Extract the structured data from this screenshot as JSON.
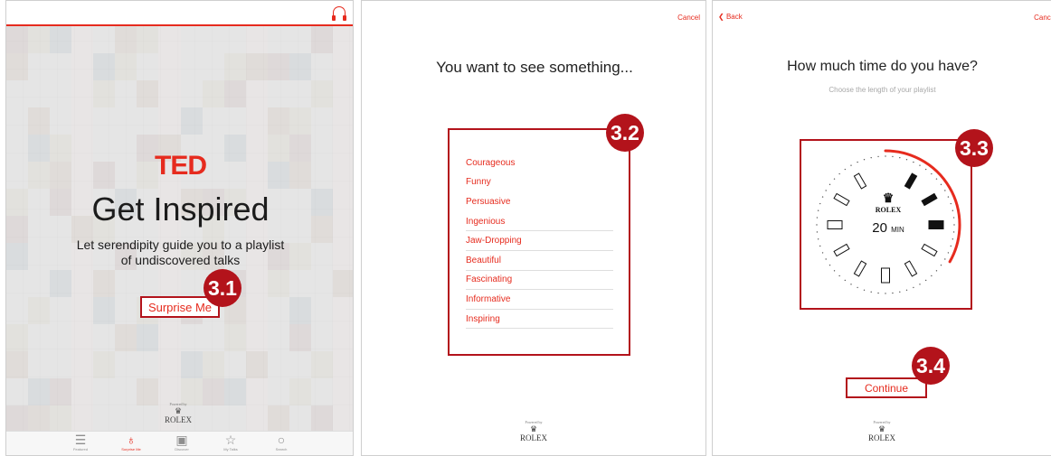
{
  "panel1": {
    "brand": "TED",
    "title": "Get Inspired",
    "subtitle": "Let serendipity guide you to a playlist of undiscovered talks",
    "surprise_button": "Surprise Me",
    "powered_by": "Powered by",
    "sponsor": "ROLEX",
    "tabs": [
      {
        "label": "Featured",
        "icon": "list-icon"
      },
      {
        "label": "Surprise Me",
        "icon": "lightbulb-icon"
      },
      {
        "label": "Discover",
        "icon": "play-box-icon"
      },
      {
        "label": "My Talks",
        "icon": "star-icon"
      },
      {
        "label": "Search",
        "icon": "search-icon"
      }
    ]
  },
  "panel2": {
    "cancel": "Cancel",
    "title": "You want to see something...",
    "options": [
      "Courageous",
      "Funny",
      "Persuasive",
      "Ingenious",
      "Jaw-Dropping",
      "Beautiful",
      "Fascinating",
      "Informative",
      "Inspiring"
    ],
    "powered_by": "Powered by",
    "sponsor": "ROLEX"
  },
  "panel3": {
    "back": "Back",
    "cancel": "Cancel",
    "title": "How much time do you have?",
    "subtitle": "Choose the length of your playlist",
    "dial_brand": "ROLEX",
    "minutes": "20",
    "minutes_unit": "MIN",
    "dial_fraction": 0.333,
    "continue_button": "Continue",
    "powered_by": "Powered by",
    "sponsor": "ROLEX"
  },
  "badges": {
    "b1": "3.1",
    "b2": "3.2",
    "b3": "3.3",
    "b4": "3.4"
  },
  "colors": {
    "accent": "#e62b1e",
    "badge": "#b3131b"
  }
}
